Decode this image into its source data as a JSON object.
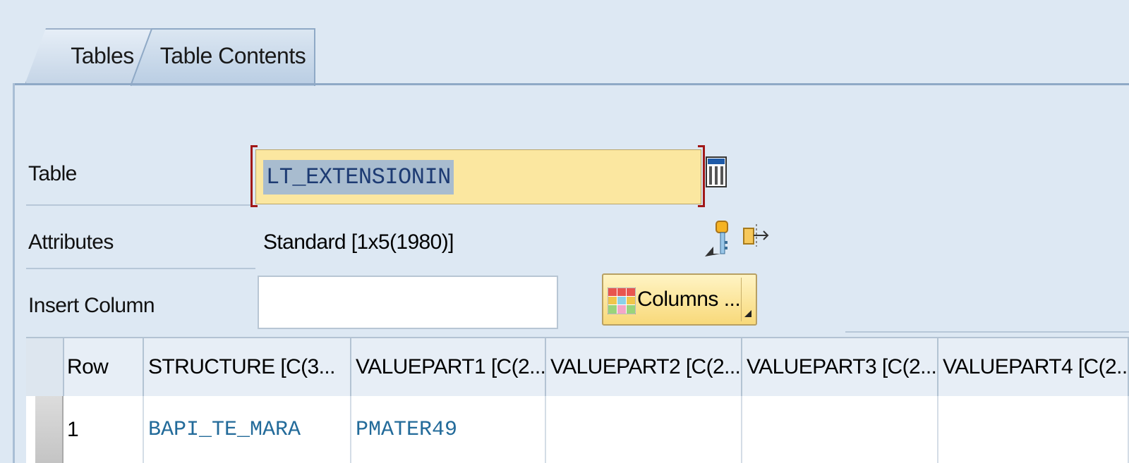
{
  "tabs": [
    {
      "label": "Tables",
      "active": false
    },
    {
      "label": "Table Contents",
      "active": true
    }
  ],
  "form": {
    "table_label": "Table",
    "table_value": "LT_EXTENSIONIN",
    "attributes_label": "Attributes",
    "attributes_value": "Standard [1x5(1980)]",
    "insert_column_label": "Insert Column",
    "insert_column_value": "",
    "columns_button_label": "Columns ..."
  },
  "grid": {
    "columns": [
      "Row",
      "STRUCTURE [C(3...",
      "VALUEPART1 [C(2...",
      "VALUEPART2 [C(2...",
      "VALUEPART3 [C(2...",
      "VALUEPART4 [C(2..."
    ],
    "rows": [
      [
        "1",
        "BAPI_TE_MARA",
        "PMATER49",
        "",
        "",
        ""
      ]
    ]
  },
  "icons": [
    "table-value-help-icon",
    "key-icon",
    "export-icon",
    "columns-grid-icon"
  ],
  "colors": {
    "background": "#dde8f3",
    "input_highlight": "#fbe7a0",
    "selection": "#a8bccf",
    "cell_text": "#236b9a",
    "required_bracket": "#a11818"
  }
}
